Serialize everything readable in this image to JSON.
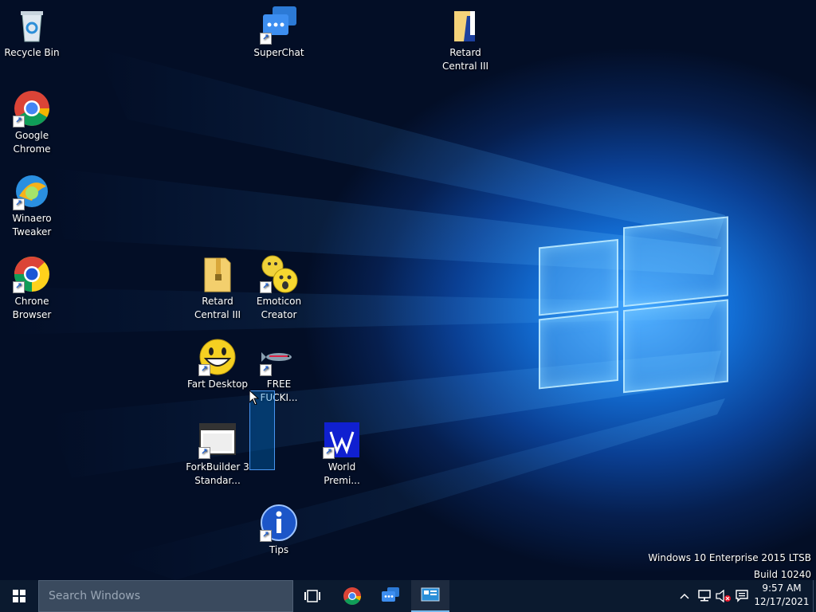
{
  "desktop": {
    "icons": [
      {
        "id": "recycle-bin",
        "label": "Recycle Bin"
      },
      {
        "id": "superchat",
        "label": "SuperChat"
      },
      {
        "id": "retard-central-top",
        "label": "Retard Central III"
      },
      {
        "id": "google-chrome",
        "label": "Google Chrome"
      },
      {
        "id": "winaero-tweaker",
        "label": "Winaero Tweaker"
      },
      {
        "id": "chrone-browser",
        "label": "Chrone Browser"
      },
      {
        "id": "retard-central-zip",
        "label": "Retard Central III"
      },
      {
        "id": "emoticon-creator",
        "label": "Emoticon Creator"
      },
      {
        "id": "fart-desktop",
        "label": "Fart Desktop"
      },
      {
        "id": "free-fucki",
        "label": "FREE FUCKI..."
      },
      {
        "id": "forkbuilder",
        "label": "ForkBuilder 3 Standar..."
      },
      {
        "id": "world-premi",
        "label": "World Premi..."
      },
      {
        "id": "tips",
        "label": "Tips"
      }
    ]
  },
  "watermark": {
    "line1": "Windows 10 Enterprise 2015 LTSB",
    "line2": "Build 10240"
  },
  "taskbar": {
    "search_placeholder": "Search Windows",
    "clock_time": "9:57 AM",
    "clock_date": "12/17/2021"
  },
  "colors": {
    "accent": "#76b9ed",
    "taskbar": "#0b1a2f"
  }
}
